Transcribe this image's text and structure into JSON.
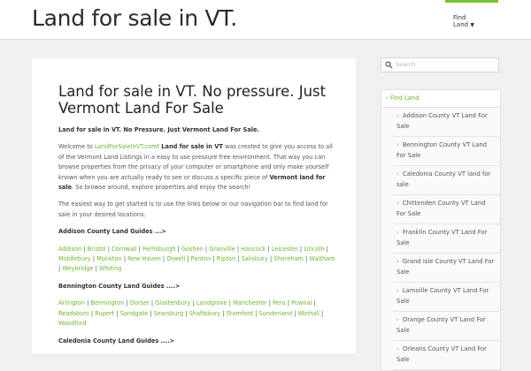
{
  "header": {
    "site_title": "Land for sale in VT.",
    "nav_item_line1": "Find",
    "nav_item_line2": "Land",
    "accent_color": "#76c62d"
  },
  "post": {
    "title": "Land for sale in VT. No pressure. Just Vermont Land For Sale",
    "lead": "Land for sale in VT. No Pressure. Just Vermont Land For Sale.",
    "intro_welcome": "Welcome to ",
    "intro_site_link": "LandForSaleInVT.com",
    "intro_after_link": "! ",
    "intro_bold1": "Land for sale in VT",
    "intro_middle": " was created to give you access to all of the Vermont Land Listings in a easy to use pressure free environment. That way you can browse properties from the privacy of your computer or smartphone and only make yourself known when you are actually ready to see or discuss a specific piece of ",
    "intro_bold2": "Vermont land for sale",
    "intro_end": ". So browse around, explore properties and enjoy the search!",
    "paragraph2": "The easiest way to get started is to use the links below or our navigation bar to find land for sale in your desired locations.",
    "sections": [
      {
        "heading": "Addison County Land Guides ...>",
        "towns": [
          "Addison",
          "Bristol",
          "Cornwall",
          "Ferrisburgh",
          "Goshen",
          "Granville",
          "Hancock",
          "Leicester",
          "Lincoln",
          "Middlebury",
          "Monkton",
          "New Haven",
          "Orwell",
          "Panton",
          "Ripton",
          "Salisbury",
          "Shoreham",
          "Waltham",
          "Weybridge",
          "Whiting"
        ]
      },
      {
        "heading": "Bennington County Land Guides ....>",
        "towns": [
          "Arlington",
          "Bennington",
          "Dorset",
          "Glastenbury",
          "Landgrove",
          "Manchester",
          "Peru",
          "Pownal",
          "Readsboro",
          "Rupert",
          "Sandgate",
          "Searsburg",
          "Shaftsbury",
          "Stamford",
          "Sunderland",
          "Winhall",
          "Woodford"
        ]
      },
      {
        "heading": "Caledonia County Land Guides ....>",
        "towns": []
      }
    ],
    "link_color": "#6cb82a"
  },
  "sidebar": {
    "search_placeholder": "Search",
    "menu_title": "Find Land",
    "items": [
      "Addison County VT Land For Sale",
      "Bennington County VT Land For Sale",
      "Caledonia County VT land for sale",
      "Chittenden County VT Land For Sale",
      "Franklin County VT Land For Sale",
      "Grand Isle County VT Land For Sale",
      "Lamoille County VT Land For Sale",
      "Orange County VT Land For Sale",
      "Orleans County VT Land For Sale"
    ]
  }
}
